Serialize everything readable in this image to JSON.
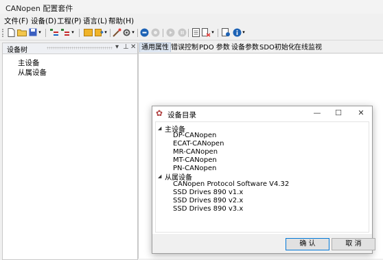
{
  "window": {
    "title": "CANopen 配置套件"
  },
  "menu": [
    "文件(F)",
    "设备(D)",
    "工程(P)",
    "语言(L)",
    "帮助(H)"
  ],
  "toolbar": {
    "icons": [
      "new-file-icon",
      "open-folder-icon",
      "save-icon",
      "dropdown-icon",
      "tree-expand-icon",
      "tree-collapse-icon",
      "dropdown-icon",
      "folder-yellow-icon",
      "export-icon",
      "dropdown-icon",
      "wand-icon",
      "gear-icon",
      "dropdown-icon",
      "connect-icon",
      "disconnect-icon",
      "play-icon",
      "pause-icon",
      "document-icon",
      "delete-icon",
      "dropdown-icon",
      "settings-doc-icon",
      "info-icon",
      "dropdown-icon"
    ]
  },
  "left_panel": {
    "title": "设备树",
    "items": [
      "主设备",
      "从属设备"
    ]
  },
  "tabs": [
    "通用属性",
    "错误控制",
    "PDO 参数",
    "设备参数",
    "SDO初始化",
    "在线监视"
  ],
  "dialog": {
    "title": "设备目录",
    "groups": [
      {
        "label": "主设备",
        "children": [
          "DP-CANopen",
          "ECAT-CANopen",
          "MR-CANopen",
          "MT-CANopen",
          "PN-CANopen"
        ]
      },
      {
        "label": "从属设备",
        "children": [
          "CANopen Protocol Software V4.32",
          "SSD Drives 890 v1.x",
          "SSD Drives 890 v2.x",
          "SSD Drives 890 v3.x"
        ]
      }
    ],
    "ok_label": "确 认",
    "cancel_label": "取 消"
  }
}
